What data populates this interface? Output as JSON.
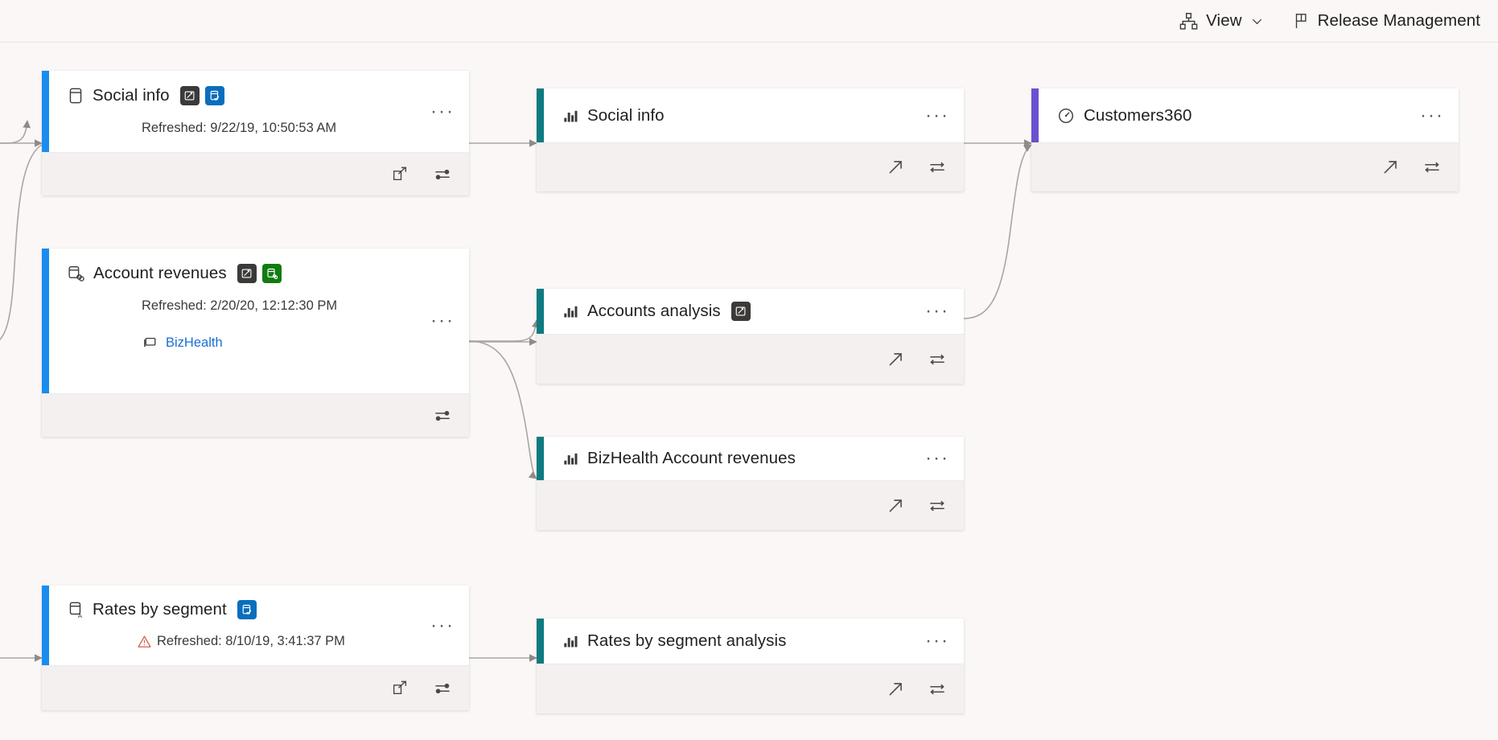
{
  "topbar": {
    "view": {
      "label": "View",
      "icon": "hierarchy-icon",
      "chevron": "chevron-down-icon"
    },
    "release_management": {
      "label": "Release Management",
      "icon": "flag-icon"
    }
  },
  "labels": {
    "ellipsis": "···",
    "chevron": "⌄"
  },
  "colors": {
    "dataset_accent": "#1a8cf0",
    "report_accent": "#0d7b80",
    "dashboard_accent": "#6b4fd1",
    "certified_badge": "#0a6ebd",
    "promoted_badge": "#3b3a39",
    "dataflow_badge": "#107c10",
    "link": "#1a6fd4",
    "warning": "#d8604a",
    "background": "#faf7f6",
    "card_footer": "#f3f0ef",
    "connector": "#a9a5a3"
  },
  "cards": [
    {
      "id": "social-info-dataset",
      "kind": "dataset",
      "accent": "blue",
      "type_icon": "dataset-icon",
      "title": "Social info",
      "badges": [
        {
          "name": "promoted-badge-icon",
          "color": "gray"
        },
        {
          "name": "certified-badge-icon",
          "color": "blue"
        }
      ],
      "refreshed": "Refreshed: 9/22/19, 10:50:53 AM",
      "warning": false,
      "workspace": null,
      "footer_icons": [
        "open-in-new-window-icon",
        "lineage-settings-icon"
      ],
      "menu": "···"
    },
    {
      "id": "account-revenues-dataset",
      "kind": "dataset",
      "accent": "blue",
      "type_icon": "dataset-linked-icon",
      "title": "Account revenues",
      "badges": [
        {
          "name": "promoted-badge-icon",
          "color": "gray"
        },
        {
          "name": "dataflow-badge-icon",
          "color": "green"
        }
      ],
      "refreshed": "Refreshed: 2/20/20, 12:12:30 PM",
      "warning": false,
      "workspace": "BizHealth",
      "footer_icons": [
        "lineage-settings-icon"
      ],
      "menu": "···"
    },
    {
      "id": "rates-by-segment-dataset",
      "kind": "dataset",
      "accent": "blue",
      "type_icon": "dataset-a-icon",
      "title": "Rates by segment",
      "badges": [
        {
          "name": "certified-badge-icon",
          "color": "blue"
        }
      ],
      "refreshed": "Refreshed: 8/10/19, 3:41:37 PM",
      "warning": true,
      "workspace": null,
      "footer_icons": [
        "open-in-new-window-icon",
        "lineage-settings-icon"
      ],
      "menu": "···"
    },
    {
      "id": "social-info-report",
      "kind": "report",
      "accent": "teal",
      "type_icon": "bar-chart-icon",
      "title": "Social info",
      "badges": [],
      "refreshed": null,
      "warning": false,
      "workspace": null,
      "footer_icons": [
        "open-report-icon",
        "lineage-settings-icon"
      ],
      "menu": "···"
    },
    {
      "id": "accounts-analysis-report",
      "kind": "report",
      "accent": "teal",
      "type_icon": "bar-chart-icon",
      "title": "Accounts analysis",
      "badges": [
        {
          "name": "promoted-badge-icon",
          "color": "gray"
        }
      ],
      "refreshed": null,
      "warning": false,
      "workspace": null,
      "footer_icons": [
        "open-report-icon",
        "lineage-settings-icon"
      ],
      "menu": "···"
    },
    {
      "id": "bizhealth-account-revenues-report",
      "kind": "report",
      "accent": "teal",
      "type_icon": "bar-chart-icon",
      "title": "BizHealth Account revenues",
      "badges": [],
      "refreshed": null,
      "warning": false,
      "workspace": null,
      "footer_icons": [
        "open-report-icon",
        "lineage-settings-icon"
      ],
      "menu": "···"
    },
    {
      "id": "rates-by-segment-analysis-report",
      "kind": "report",
      "accent": "teal",
      "type_icon": "bar-chart-icon",
      "title": "Rates by segment analysis",
      "badges": [],
      "refreshed": null,
      "warning": false,
      "workspace": null,
      "footer_icons": [
        "open-report-icon",
        "lineage-settings-icon"
      ],
      "menu": "···"
    },
    {
      "id": "customers360-dashboard",
      "kind": "dashboard",
      "accent": "purple",
      "type_icon": "dashboard-gauge-icon",
      "title": "Customers360",
      "badges": [],
      "refreshed": null,
      "warning": false,
      "workspace": null,
      "footer_icons": [
        "open-dashboard-icon",
        "lineage-settings-icon"
      ],
      "menu": "···"
    }
  ]
}
